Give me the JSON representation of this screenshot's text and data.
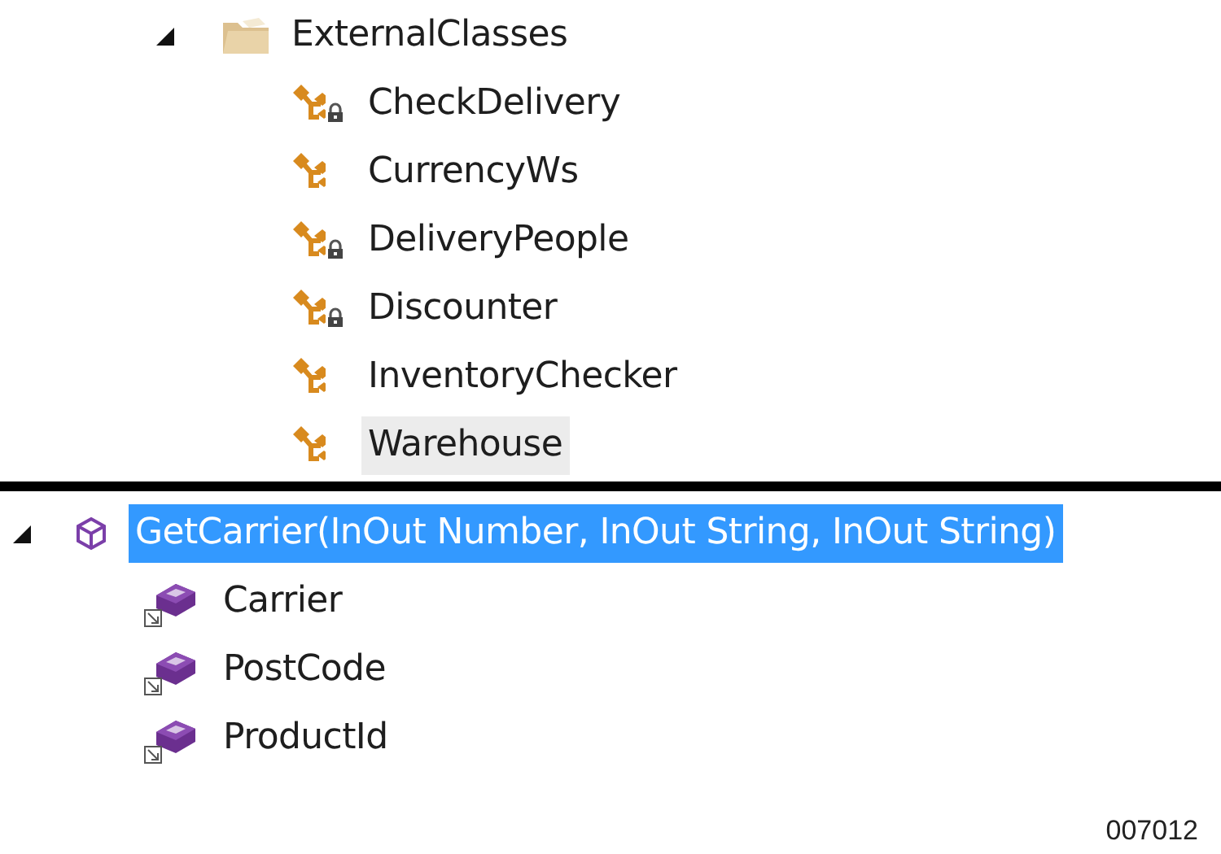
{
  "panels": [
    {
      "focused": false,
      "root": {
        "label": "ExternalClasses",
        "kind": "folder",
        "expanded": true,
        "selected": false,
        "children": [
          {
            "label": "CheckDelivery",
            "kind": "class",
            "locked": true,
            "selected": false
          },
          {
            "label": "CurrencyWs",
            "kind": "class",
            "locked": false,
            "selected": false
          },
          {
            "label": "DeliveryPeople",
            "kind": "class",
            "locked": true,
            "selected": false
          },
          {
            "label": "Discounter",
            "kind": "class",
            "locked": true,
            "selected": false
          },
          {
            "label": "InventoryChecker",
            "kind": "class",
            "locked": false,
            "selected": false
          },
          {
            "label": "Warehouse",
            "kind": "class",
            "locked": false,
            "selected": true
          }
        ]
      }
    },
    {
      "focused": true,
      "root": {
        "label": "GetCarrier(InOut Number, InOut String, InOut String)",
        "kind": "method",
        "expanded": true,
        "selected": true,
        "children": [
          {
            "label": "Carrier",
            "kind": "parameter",
            "selected": false
          },
          {
            "label": "PostCode",
            "kind": "parameter",
            "selected": false
          },
          {
            "label": "ProductId",
            "kind": "parameter",
            "selected": false
          }
        ]
      }
    }
  ],
  "figure_number": "007012"
}
